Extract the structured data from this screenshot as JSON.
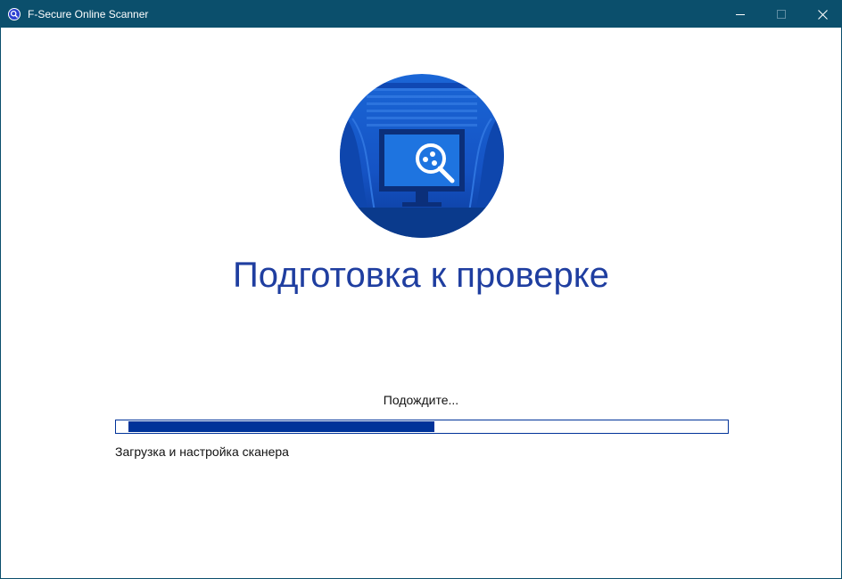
{
  "window": {
    "title": "F-Secure Online Scanner",
    "app_icon": "fsecure-scanner-icon",
    "controls": {
      "minimize_icon": "minimize-icon",
      "maximize_icon": "maximize-icon",
      "close_icon": "close-icon"
    }
  },
  "colors": {
    "titlebar": "#0b4f6c",
    "heading": "#1f3ea0",
    "progress": "#003399",
    "hero_dark": "#0a3a8c",
    "hero_light": "#2f7fe0"
  },
  "main": {
    "hero_icon": "monitor-magnifier-icon",
    "heading": "Подготовка к проверке",
    "wait_text": "Подождите...",
    "progress": {
      "start_fraction": 0.02,
      "end_fraction": 0.52
    },
    "status_text": "Загрузка и настройка сканера"
  }
}
